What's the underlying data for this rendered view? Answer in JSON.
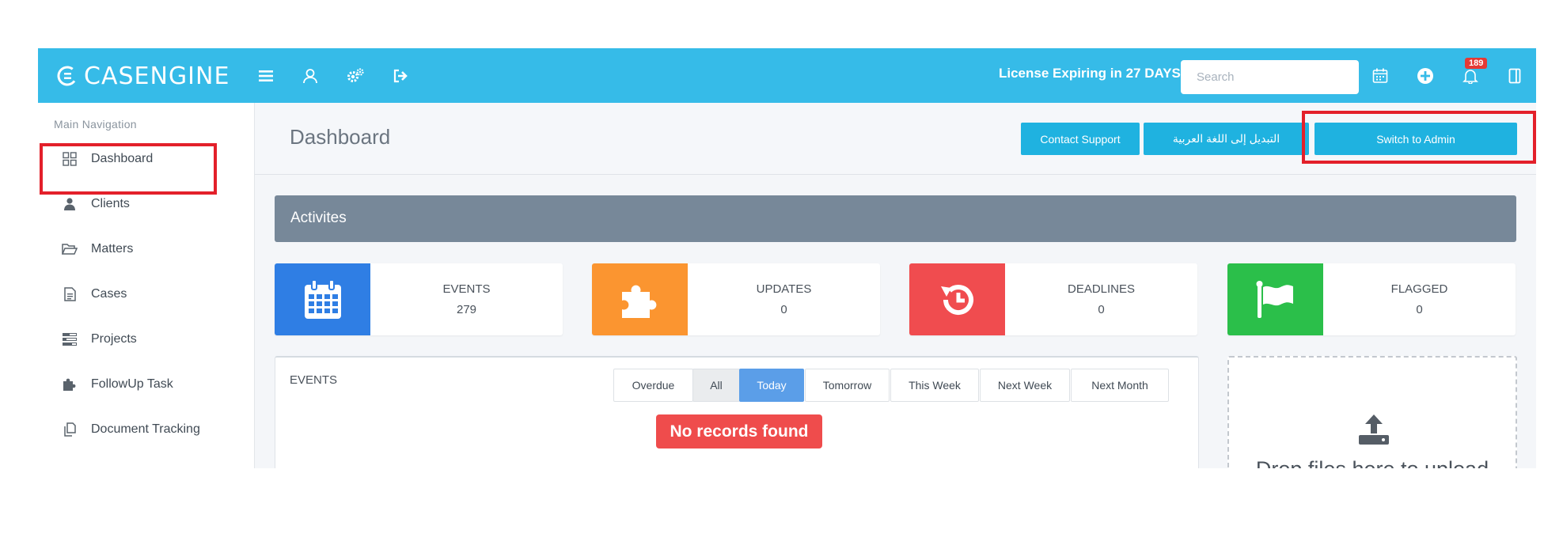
{
  "app": {
    "logo_text": "CASENGINE"
  },
  "topbar": {
    "license_text": "License Expiring in 27 DAYS",
    "search_placeholder": "Search",
    "notification_count": "189",
    "icons": [
      "menu-icon",
      "user-icon",
      "settings-icon",
      "logout-icon",
      "calendar-icon",
      "add-icon",
      "bell-icon",
      "panel-icon"
    ]
  },
  "sidebar": {
    "heading": "Main Navigation",
    "items": [
      {
        "label": "Dashboard",
        "icon": "grid-icon"
      },
      {
        "label": "Clients",
        "icon": "person-icon"
      },
      {
        "label": "Matters",
        "icon": "folder-open-icon"
      },
      {
        "label": "Cases",
        "icon": "file-text-icon"
      },
      {
        "label": "Projects",
        "icon": "tasks-icon"
      },
      {
        "label": "FollowUp Task",
        "icon": "puzzle-icon"
      },
      {
        "label": "Document Tracking",
        "icon": "copy-icon"
      }
    ]
  },
  "header": {
    "title": "Dashboard",
    "buttons": {
      "contact_support": "Contact Support",
      "arabic": "التبديل إلى اللغة العربية",
      "switch_admin": "Switch to Admin"
    }
  },
  "activities": {
    "title": "Activites",
    "stats": [
      {
        "label": "EVENTS",
        "value": "279",
        "color": "#2f7ee4",
        "icon": "calendar-icon"
      },
      {
        "label": "UPDATES",
        "value": "0",
        "color": "#fb9530",
        "icon": "puzzle-icon"
      },
      {
        "label": "DEADLINES",
        "value": "0",
        "color": "#f04c4f",
        "icon": "history-icon"
      },
      {
        "label": "FLAGGED",
        "value": "0",
        "color": "#2bbf4a",
        "icon": "flag-icon"
      }
    ]
  },
  "events": {
    "title": "EVENTS",
    "filters": [
      "Overdue",
      "All",
      "Today",
      "Tomorrow",
      "This Week",
      "Next Week",
      "Next Month"
    ],
    "active_filter": "Today",
    "empty_message": "No records found"
  },
  "upload": {
    "text": "Drop files here to upload"
  },
  "colors": {
    "topbar": "#36bbe8",
    "button": "#1fb2e0",
    "highlight": "#e3202a",
    "activities_header": "#778899"
  }
}
